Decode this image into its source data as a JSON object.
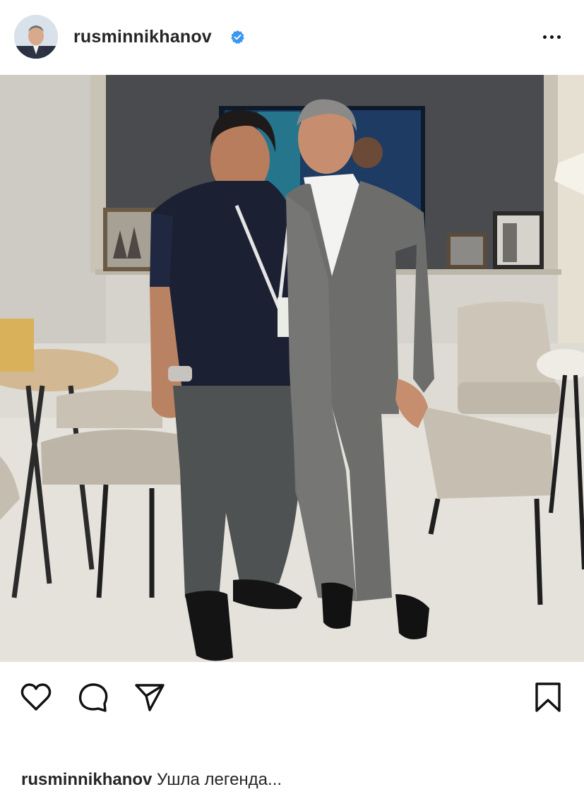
{
  "post": {
    "username": "rusminnikhanov",
    "verified": true,
    "more_icon": "more-horizontal-icon",
    "caption_text": "Ушла легенда..."
  },
  "actions": {
    "like_icon": "heart-icon",
    "comment_icon": "comment-icon",
    "share_icon": "send-icon",
    "save_icon": "bookmark-icon"
  },
  "colors": {
    "verified_badge": "#3897f0",
    "text": "#262626"
  }
}
